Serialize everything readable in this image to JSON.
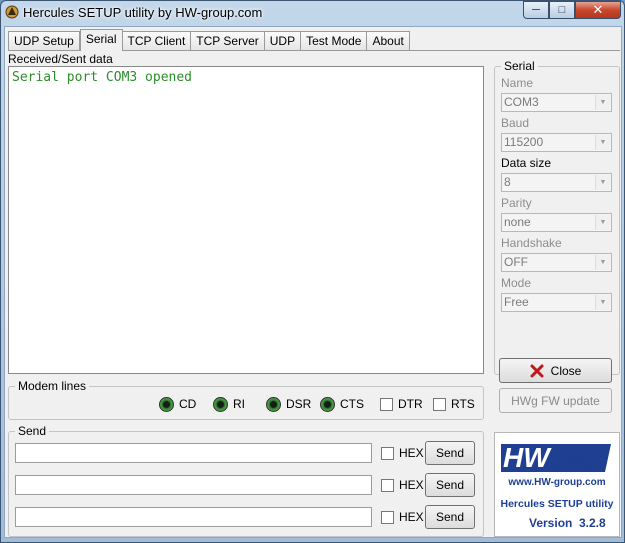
{
  "window": {
    "title": "Hercules SETUP utility by HW-group.com"
  },
  "tabs": [
    {
      "label": "UDP Setup",
      "active": false
    },
    {
      "label": "Serial",
      "active": true
    },
    {
      "label": "TCP Client",
      "active": false
    },
    {
      "label": "TCP Server",
      "active": false
    },
    {
      "label": "UDP",
      "active": false
    },
    {
      "label": "Test Mode",
      "active": false
    },
    {
      "label": "About",
      "active": false
    }
  ],
  "received": {
    "label": "Received/Sent data",
    "text": "Serial port COM3 opened"
  },
  "modem": {
    "title": "Modem lines",
    "leds": [
      "CD",
      "RI",
      "DSR",
      "CTS"
    ],
    "checks": [
      "DTR",
      "RTS"
    ]
  },
  "send": {
    "title": "Send",
    "hex_label": "HEX",
    "button_label": "Send",
    "rows": [
      {
        "value": ""
      },
      {
        "value": ""
      },
      {
        "value": ""
      }
    ]
  },
  "serial": {
    "title": "Serial",
    "fields": [
      {
        "label": "Name",
        "value": "COM3"
      },
      {
        "label": "Baud",
        "value": "115200"
      },
      {
        "label": "Data size",
        "value": "8"
      },
      {
        "label": "Parity",
        "value": "none"
      },
      {
        "label": "Handshake",
        "value": "OFF"
      },
      {
        "label": "Mode",
        "value": "Free"
      }
    ],
    "close_label": "Close",
    "fw_label": "HWg FW update"
  },
  "logo": {
    "brand": "HW",
    "group": "group",
    "url": "www.HW-group.com",
    "product": "Hercules SETUP utility",
    "version_label": "Version",
    "version": "3.2.8"
  },
  "colors": {
    "received_text": "#2e8b2e",
    "logo_blue": "#1f3f93",
    "close_x": "#c0171c"
  }
}
